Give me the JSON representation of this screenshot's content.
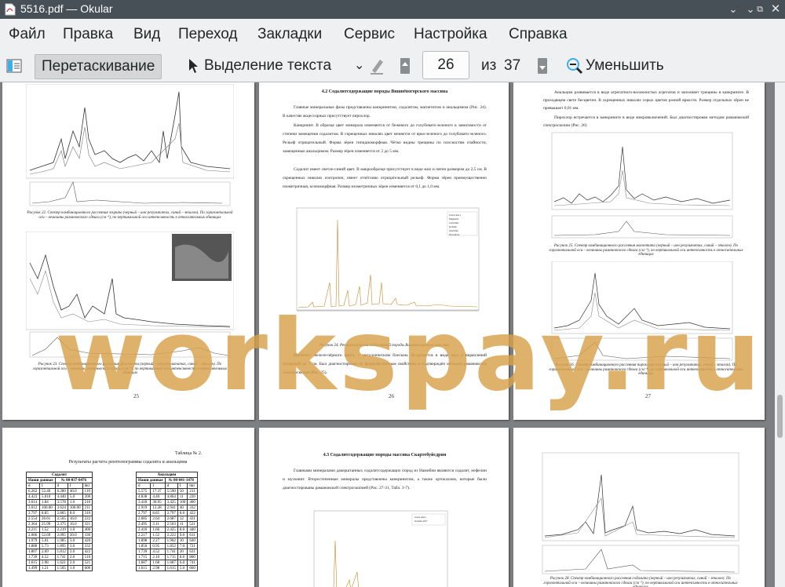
{
  "window": {
    "title": "5516.pdf  — Okular"
  },
  "menu": [
    "Файл",
    "Правка",
    "Вид",
    "Переход",
    "Закладки",
    "Сервис",
    "Настройка",
    "Справка"
  ],
  "toolbar": {
    "drag_label": "Перетаскивание",
    "select_label": "Выделение текста",
    "page_current": "26",
    "page_of": "из",
    "page_total": "37",
    "zoom_out_label": "Уменьшить"
  },
  "pages": {
    "p25": {
      "caption1": "Рисунок 22. Спектр комбинационного рассеяния эгирина (черный – ион результатах, синий – эталон). По горизонтальной оси – величины рамановского сдвига (см⁻¹), по вертикальной оси интенсивность в относительных единицах",
      "caption2": "Рисунок 23. Спектр комбинационного рассеяния флогопита (черный – ион результатах, синий – эталон). По горизонтальной оси – величины рамановского сдвига (см⁻¹), по вертикальной оси интенсивность в относительных единицах",
      "number": "25"
    },
    "p26": {
      "heading": "4.2 Содалитсодержащие породы Вишнёвогорского массива",
      "para1": "Главные минеральные фазы представлены канкринитом, содалитом, магнетитом и анальцимом (Рис. 24). В качестве акцессорных присутствует пирохлор.",
      "para2": "Канкринит. В образце цвет минерала изменяется от бежевого до голубовато-зеленого в зависимости от степени замещения содалитом. В скрещенных николях цвет меняется от ярко-зеленого до голубовато-зеленого. Рельеф отрицательный. Форма зёрен гипидиоморфная. Чётко видны трещины по плоскостям спайности, замещенные анальцимом. Размер зёрен изменяется от 2 до 5 мм.",
      "para3": "Содалит имеет светло-синий цвет. В макрообразце присутствует в виде жил и пятен размером до 2,5 см. В скрещенных николях изотропен, имеет отчётливо отрицательный рельеф. Форма зёрен преимущественно изометричная, ксеноморфная. Размер изометричных зёрен изменяется от 0,1 до 1,0 мм.",
      "legend": [
        "Green data 1",
        "Magnetite",
        "Cancrinite",
        "Sodalite",
        "Analcime",
        "Pyrochlore"
      ],
      "caption": "Рисунок 24. Рентгенограмма содалитовой породы Вишнёвогорского массива.",
      "para4": "Магнетит железо-чёрного цвета, с металлическим блеском. Встречается в виде жил и вкраплений толщиной до 1 см. Был диагностирован по ферромагнитным свойствам и подтверждён методом рамановской спектроскопии (Рис. 25).",
      "number": "26"
    },
    "p27": {
      "para1": "Анальцим развивается в виде агрегатного-волокнистых агрегатов и заполняет трещины в канкрините. В проходящем свете бесцветен. В скрещенных николях серых цветов разной яркости. Размер отдельных зёрен не превышает 0,01 мм.",
      "para2": "Пирохлор встречается в канкрините в виде микровключений. Был диагностирован методом рамановской спектроскопии (Рис. 26)",
      "caption1": "Рисунок 25. Спектр комбинационного рассеяния магнетита (черный – ион результатах, синий – эталон). По горизонтальной оси – величины рамановского сдвига (см⁻¹), по вертикальной оси интенсивность в относительных единицах",
      "caption2": "Рисунок 26. Спектр комбинационного рассеяния пирохлора (черный – ион результатах, синий – эталон). По горизонтальной оси – величины рамановского сдвига (см⁻¹), по вертикальной оси интенсивность в относительных единицах",
      "number": "27"
    },
    "p28": {
      "table_title": "Таблица № 2.",
      "subtitle": "Результаты расчета рентгенограммы содалита и анальцима",
      "col_sodalite": "Содалит",
      "col_analcime": "Анальцим",
      "sub_ours": "Наши данные",
      "sub_ref_sod": "№ 00-037-0476",
      "sub_ref_anl": "№ 00-041-1478",
      "cols": [
        "d",
        "I",
        "d",
        "I",
        "hkl"
      ],
      "rows_sod": [
        [
          "6.262",
          "52.40",
          "6.280",
          "40.0",
          "110"
        ],
        [
          "4.423",
          "5.010",
          "4.440",
          "5.0",
          "200"
        ],
        [
          "3.614",
          "1.84",
          "3.578",
          "1.0",
          "210"
        ],
        [
          "3.612",
          "100.00",
          "3.624",
          "100.00",
          "211"
        ],
        [
          "2.797",
          "8.85",
          "2.805",
          "8.0",
          "310"
        ],
        [
          "2.554",
          "26.61",
          "2.565",
          "16.0",
          "222"
        ],
        [
          "2.364",
          "25.99",
          "2.375",
          "16.0",
          "321"
        ],
        [
          "2.211",
          "1.52",
          "2.219",
          "1.0",
          "400"
        ],
        [
          "2.086",
          "52.69",
          "2.095",
          "20.0",
          "330"
        ],
        [
          "1.979",
          "5.01",
          "1.985",
          "3.0",
          "420"
        ],
        [
          "1.888",
          "5.73",
          "1.895",
          "3.0",
          "332"
        ],
        [
          "1.807",
          "2.69",
          "1.812",
          "2.0",
          "422"
        ],
        [
          "1.739",
          "4.52",
          "1.741",
          "2.0",
          "510"
        ],
        [
          "1.615",
          "2.98",
          "1.621",
          "2.0",
          "521"
        ],
        [
          "1.499",
          "1.21",
          "1.505",
          "1.0",
          "600"
        ]
      ],
      "rows_anl": [
        [
          "5.575",
          "17.37",
          "5.590",
          "50",
          "211"
        ],
        [
          "4.838",
          "4.40",
          "4.864",
          "11",
          "220"
        ],
        [
          "3.418",
          "30.95",
          "3.425",
          "100",
          "400"
        ],
        [
          "2.919",
          "12.28",
          "2.941",
          "40",
          "332"
        ],
        [
          "2.797",
          "8.85",
          "2.797",
          "8.0",
          "422"
        ],
        [
          "2.685",
          "2.64",
          "2.687",
          "12",
          "431"
        ],
        [
          "2.495",
          "3.11",
          "2.503",
          "11",
          "521"
        ],
        [
          "2.416",
          "1.66",
          "2.425",
          "8.0",
          "440"
        ],
        [
          "2.217",
          "1.52",
          "2.222",
          "9.0",
          "611"
        ],
        [
          "1.898",
          "2.27",
          "1.902",
          "10",
          "640"
        ],
        [
          "1.856",
          "0.95",
          "1.852",
          "7.0",
          "721"
        ],
        [
          "1.739",
          "4.52",
          "1.741",
          "20",
          "631"
        ],
        [
          "1.715",
          "2.10",
          "1.715",
          "8.0",
          "800"
        ],
        [
          "1.687",
          "1.68",
          "1.687",
          "6.0",
          "741"
        ],
        [
          "1.615",
          "2.98",
          "1.615",
          "5.0",
          "660"
        ]
      ]
    },
    "p29": {
      "heading": "4.3 Содалитсодержащие породы массива Скартебуйсдрин",
      "para1": "Главными минералами дакерштанных содалитсодержащих пород из Намибии являются содалит, нефелин и мусковит. Второстепенные минералы представлены канкринитом, а также ортоклазом, которые были диагностированы рамановской спектроскопией (Рис. 27-31, Табл. 3-7).",
      "legend": [
        "Green data 1",
        "Sodalite 2017"
      ]
    },
    "p30": {
      "caption": "Рисунок 28. Спектр комбинационного рассеяния содалита (черный – ион результатах, синий – эталон). По горизонтальной оси – величины рамановского сдвига (см⁻¹), по вертикальной оси интенсивность в относительных единицах"
    }
  },
  "watermark": "workspay.ru"
}
